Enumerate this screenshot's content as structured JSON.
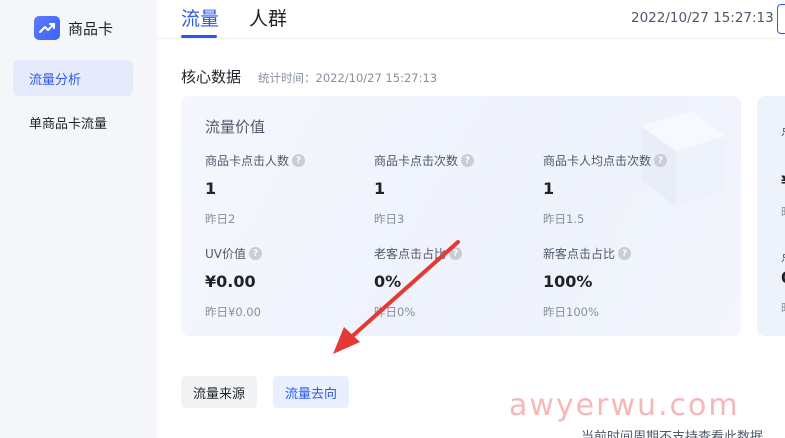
{
  "sidebar": {
    "brand": "商品卡",
    "items": [
      {
        "label": "流量分析",
        "active": true
      },
      {
        "label": "单商品卡流量",
        "active": false
      }
    ]
  },
  "header": {
    "tabs": [
      {
        "label": "流量",
        "active": true
      },
      {
        "label": "人群",
        "active": false
      }
    ],
    "timestamp": "2022/10/27 15:27:13"
  },
  "core": {
    "title": "核心数据",
    "stat_time": "统计时间：2022/10/27 15:27:13"
  },
  "card": {
    "title": "流量价值",
    "metrics": [
      {
        "label": "商品卡点击人数",
        "value": "1",
        "prev": "昨日2"
      },
      {
        "label": "商品卡点击次数",
        "value": "1",
        "prev": "昨日3"
      },
      {
        "label": "商品卡人均点击次数",
        "value": "1",
        "prev": "昨日1.5"
      },
      {
        "label": "UV价值",
        "value": "¥0.00",
        "prev": "昨日¥0.00"
      },
      {
        "label": "老客点击占比",
        "value": "0%",
        "prev": "昨日0%"
      },
      {
        "label": "新客点击占比",
        "value": "100%",
        "prev": "昨日100%"
      }
    ]
  },
  "card2_fragments": [
    "点",
    "¥",
    "昨",
    "点",
    "0",
    "昨"
  ],
  "buttons": {
    "source": "流量来源",
    "destination": "流量去向"
  },
  "watermark": "awyerwu.com",
  "bottom_note": "当前时间周期不支持查看此数据",
  "colors": {
    "accent": "#2f5ae8",
    "arrow": "#e53935"
  }
}
